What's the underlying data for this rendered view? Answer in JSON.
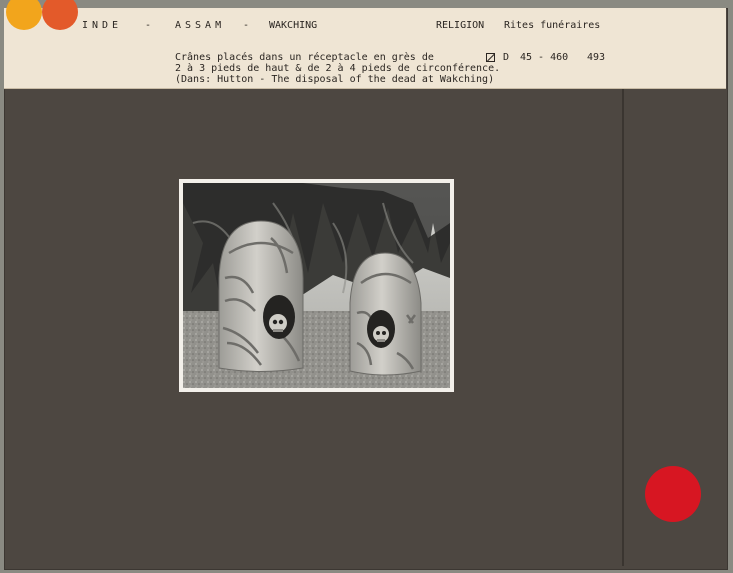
{
  "header": {
    "country": "INDE",
    "sep1": "-",
    "region": "ASSAM",
    "sep2": "-",
    "locality": "WAKCHING",
    "category": "RELIGION",
    "subcategory": "Rites funéraires"
  },
  "caption": {
    "line1": "Crânes placés dans un réceptacle en grès de",
    "line2": "2 à 3 pieds de haut & de 2 à 4 pieds de circonférence.",
    "line3": "(Dans: Hutton - The disposal of the dead at Wakching)"
  },
  "reference": {
    "prefix": "D",
    "code": "45 - 460",
    "number": "493"
  },
  "colors": {
    "board": "#4d4741",
    "label_paper": "#efe5d4",
    "seal_red": "#d71622",
    "tab_orange": "#f2a51c",
    "tab_red": "#e35a2a"
  }
}
